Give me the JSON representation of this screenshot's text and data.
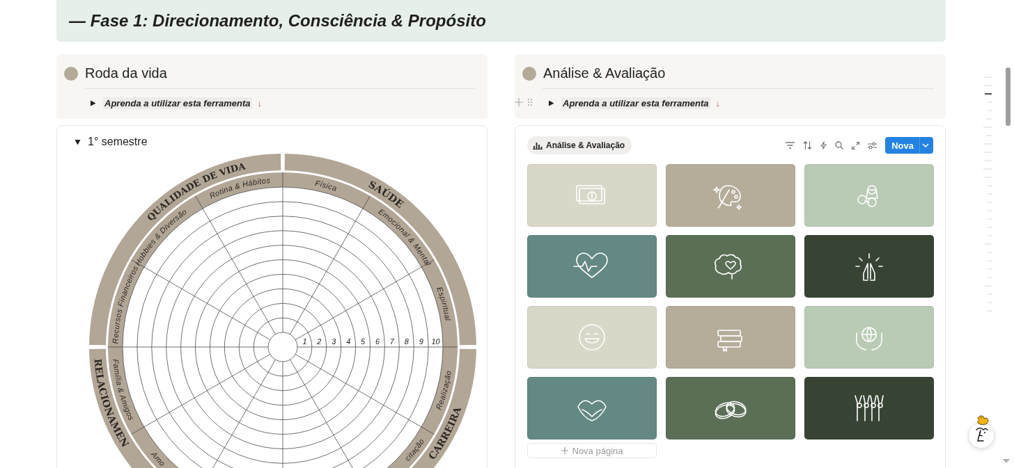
{
  "header": {
    "title": "— Fase 1: Direcionamento, Consciência & Propósito"
  },
  "callouts": [
    {
      "heading": "Roda da vida",
      "hovered": false,
      "toggle": {
        "text": "Aprenda a utilizar esta ferramenta",
        "arrow": "↓",
        "expanded": false
      }
    },
    {
      "heading": "Análise & Avaliação",
      "hovered": true,
      "toggle": {
        "text": "Aprenda a utilizar esta ferramenta",
        "arrow": "↓",
        "expanded": false
      }
    }
  ],
  "wheel": {
    "toggle": {
      "text": "1° semestre",
      "expanded": true
    },
    "categories": [
      "QUALIDADE DE VIDA",
      "SAÚDE",
      "RELACIONAMEN",
      "CARREIRA"
    ],
    "areas": [
      "Rotina & Hábitos",
      "Física",
      "Hobbies & Diversão",
      "Emocional & Mental",
      "Recursos Financeiros",
      "Espiritual",
      "Família & Amigos",
      "Realização",
      "Amo",
      "citação"
    ],
    "scale": [
      "1",
      "2",
      "3",
      "4",
      "5",
      "6",
      "7",
      "8",
      "9",
      "10"
    ]
  },
  "gallery": {
    "view_tab": {
      "label": "Análise & Avaliação",
      "selected": true
    },
    "new_button": {
      "label": "Nova"
    },
    "tiles": [
      {
        "color": "#d9d7c7"
      },
      {
        "color": "#b5ad9a"
      },
      {
        "color": "#b9cbb4"
      },
      {
        "color": "#648883"
      },
      {
        "color": "#5b6f56"
      },
      {
        "color": "#374434"
      },
      {
        "color": "#d9d7c7"
      },
      {
        "color": "#b5ad9a"
      },
      {
        "color": "#b9cbb4"
      },
      {
        "color": "#648883"
      },
      {
        "color": "#5b6f56"
      },
      {
        "color": "#374434"
      }
    ],
    "new_page": {
      "label": "Nova página"
    }
  }
}
